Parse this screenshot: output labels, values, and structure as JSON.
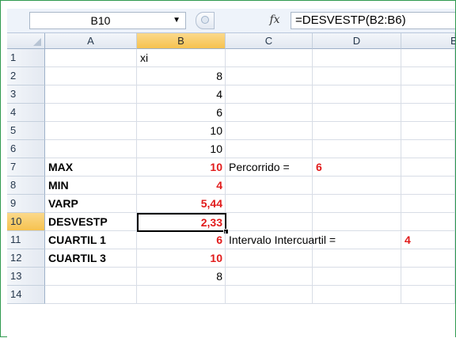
{
  "formula_bar": {
    "name_box": "B10",
    "dropdown_icon": "▼",
    "fx_label": "fx",
    "formula": "=DESVESTP(B2:B6)"
  },
  "columns": [
    "A",
    "B",
    "C",
    "D",
    "E"
  ],
  "rows": [
    "1",
    "2",
    "3",
    "4",
    "5",
    "6",
    "7",
    "8",
    "9",
    "10",
    "11",
    "12",
    "13",
    "14"
  ],
  "cells": {
    "B1": "xi",
    "B2": "8",
    "B3": "4",
    "B4": "6",
    "B5": "10",
    "B6": "10",
    "A7": "MAX",
    "B7": "10",
    "C7": "Percorrido =",
    "D7": "6",
    "A8": "MIN",
    "B8": "4",
    "A9": "VARP",
    "B9": "5,44",
    "A10": "DESVESTP",
    "B10": "2,33",
    "A11": "CUARTIL 1",
    "B11": "6",
    "C11": "Intervalo Intercuartil =",
    "D11": "4",
    "A12": "CUARTIL 3",
    "B12": "10",
    "B13": "8"
  },
  "colors": {
    "highlight_value": "#e11b1b",
    "selected_header": "#f6c24f",
    "frame_border": "#2f9a4f"
  }
}
